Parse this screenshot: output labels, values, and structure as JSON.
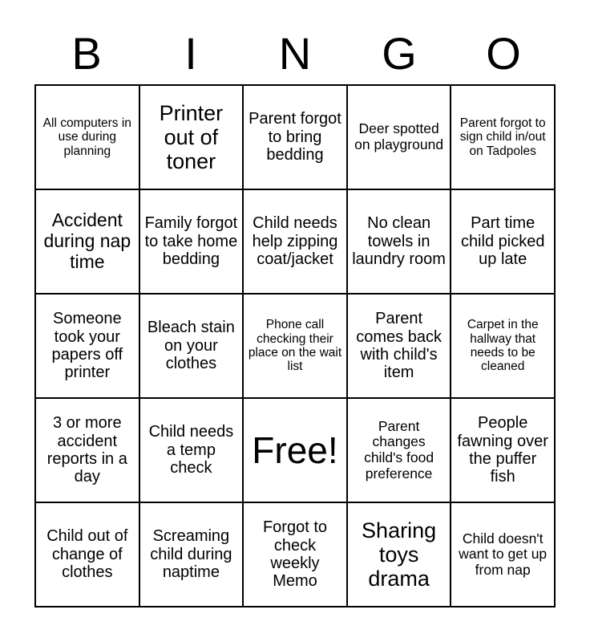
{
  "card": {
    "header_letters": [
      "B",
      "I",
      "N",
      "G",
      "O"
    ],
    "columns": 5,
    "rows": 5,
    "colors": {
      "background": "#ffffff",
      "border": "#000000",
      "text": "#000000"
    },
    "cells": [
      {
        "text": "All computers in use during planning",
        "size": "xs"
      },
      {
        "text": "Printer out of toner",
        "size": "xl"
      },
      {
        "text": "Parent forgot to bring bedding",
        "size": "md"
      },
      {
        "text": "Deer spotted on playground",
        "size": "sm"
      },
      {
        "text": "Parent forgot to sign child in/out on Tadpoles",
        "size": "xs"
      },
      {
        "text": "Accident during nap time",
        "size": "lg"
      },
      {
        "text": "Family forgot to take home bedding",
        "size": "md"
      },
      {
        "text": "Child needs help zipping coat/jacket",
        "size": "md"
      },
      {
        "text": "No clean towels in laundry room",
        "size": "md"
      },
      {
        "text": "Part time child picked up late",
        "size": "md"
      },
      {
        "text": "Someone took your papers off printer",
        "size": "md"
      },
      {
        "text": "Bleach stain on your clothes",
        "size": "md"
      },
      {
        "text": "Phone call checking their place on the wait list",
        "size": "xs"
      },
      {
        "text": "Parent comes back with child's item",
        "size": "md"
      },
      {
        "text": "Carpet in the hallway that needs to be cleaned",
        "size": "xs"
      },
      {
        "text": "3 or more accident reports in a day",
        "size": "md"
      },
      {
        "text": "Child needs a temp check",
        "size": "md"
      },
      {
        "text": "Free!",
        "size": "free"
      },
      {
        "text": "Parent changes child's food preference",
        "size": "sm"
      },
      {
        "text": "People fawning over the puffer fish",
        "size": "md"
      },
      {
        "text": "Child out of change of clothes",
        "size": "md"
      },
      {
        "text": "Screaming child during naptime",
        "size": "md"
      },
      {
        "text": "Forgot to check weekly Memo",
        "size": "md"
      },
      {
        "text": "Sharing toys drama",
        "size": "xl"
      },
      {
        "text": "Child doesn't want to get up from nap",
        "size": "sm"
      }
    ]
  }
}
